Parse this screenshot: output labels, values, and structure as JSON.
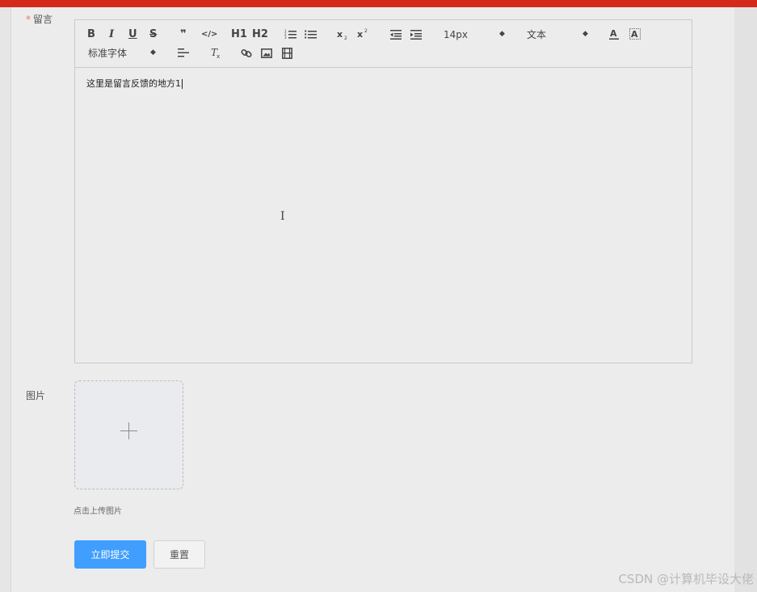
{
  "colors": {
    "topbar": "#d42a1c",
    "primary": "#409eff",
    "required": "#f56c6c"
  },
  "form": {
    "message_required_mark": "*",
    "message_label": "留言",
    "image_label": "图片",
    "upload_tip": "点击上传图片"
  },
  "toolbar": {
    "bold": "B",
    "italic": "I",
    "underline": "U",
    "strike": "S",
    "blockquote": "❞",
    "code": "</>",
    "h1": "H1",
    "h2": "H2",
    "font_size": "14px",
    "header": "文本",
    "font_family": "标准字体"
  },
  "editor": {
    "content": "这里是留言反馈的地方1"
  },
  "buttons": {
    "submit": "立即提交",
    "reset": "重置"
  },
  "watermark": "CSDN @计算机毕设大佬"
}
